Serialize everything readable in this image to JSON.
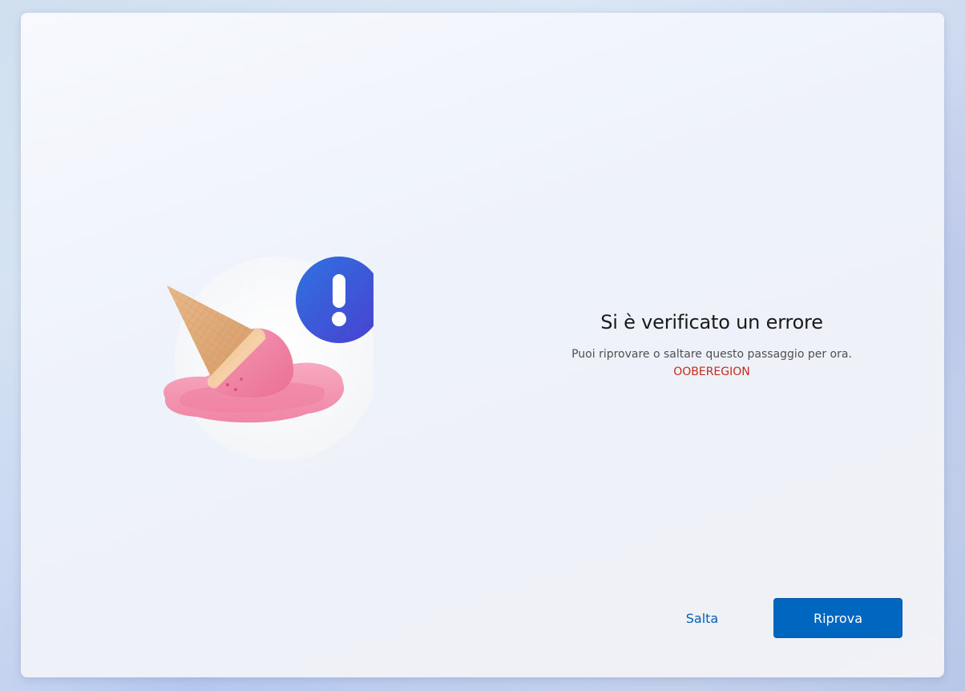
{
  "error_page": {
    "title": "Si è verificato un errore",
    "message": "Puoi riprovare o saltare questo passaggio per ora.",
    "error_code": "OOBEREGION"
  },
  "actions": {
    "skip_label": "Salta",
    "retry_label": "Riprova"
  },
  "colors": {
    "accent": "#0067c0",
    "link": "#005fb8",
    "error": "#c42b1c",
    "badge": "#3b5bd6"
  },
  "icons": {
    "illustration": "dropped-ice-cream-icon",
    "badge": "exclamation-icon"
  }
}
